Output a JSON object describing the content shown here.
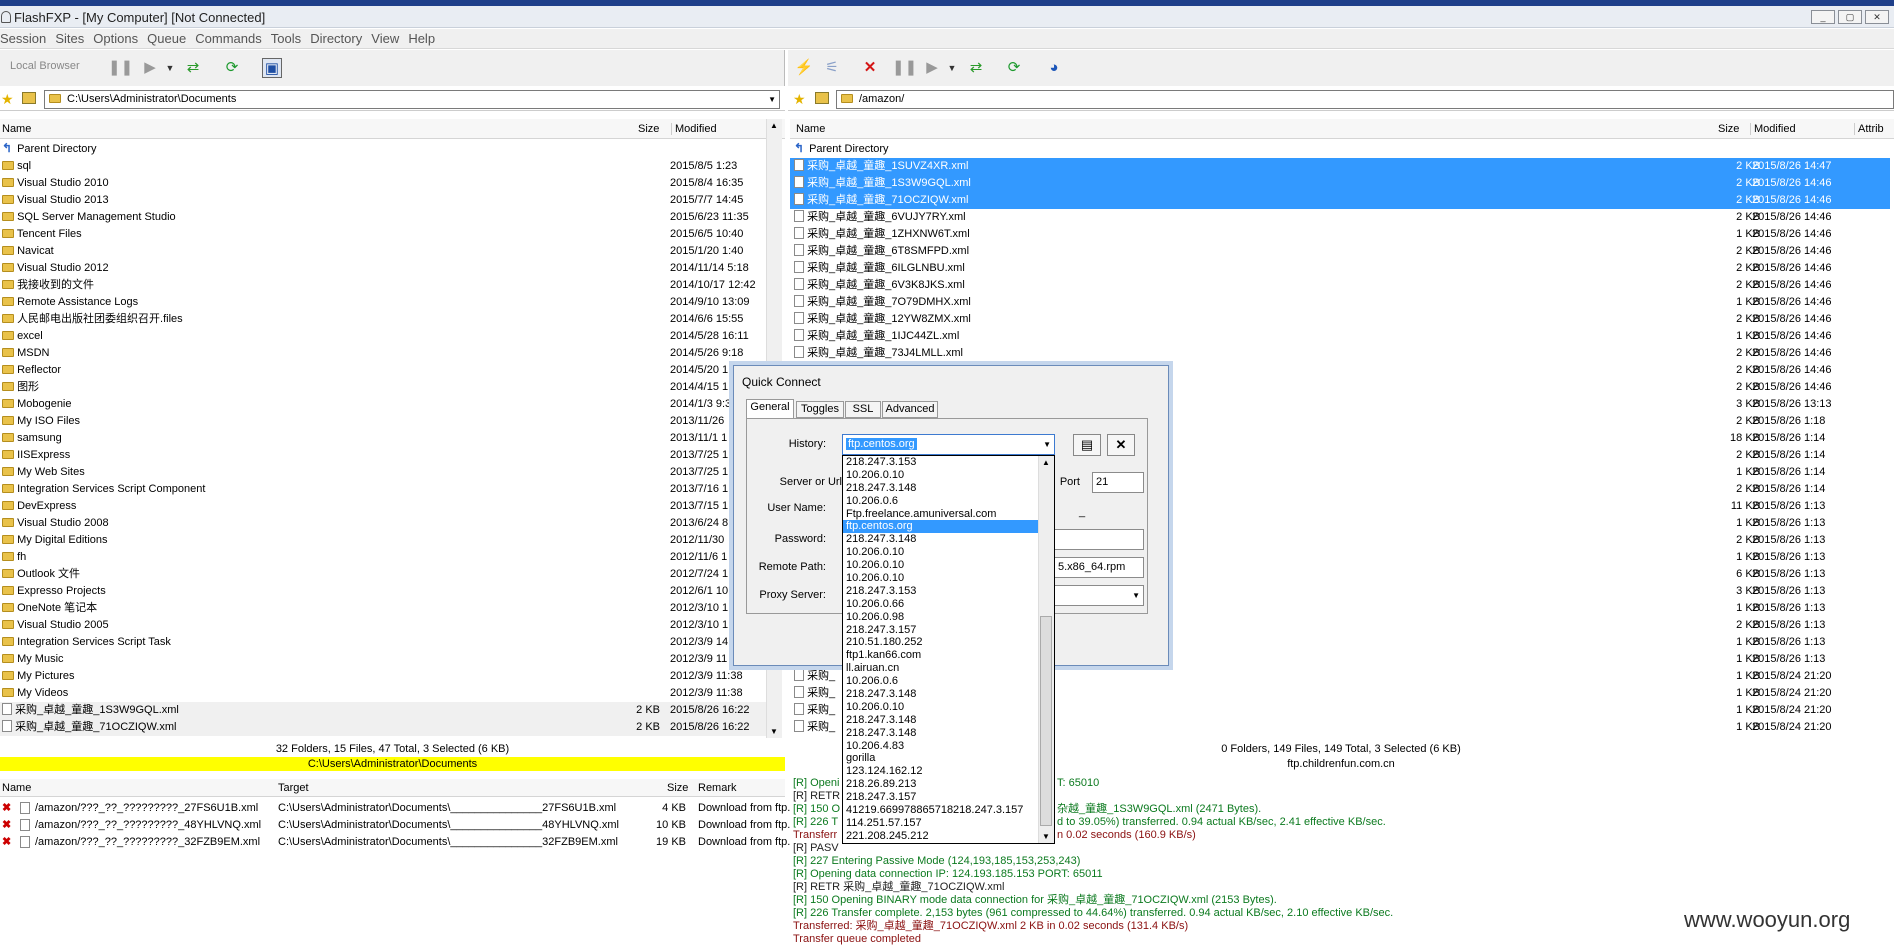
{
  "window": {
    "title": "FlashFXP - [My Computer]   [Not Connected]",
    "controls": [
      "_",
      "▢",
      "✕"
    ]
  },
  "menu": [
    "Session",
    "Sites",
    "Options",
    "Queue",
    "Commands",
    "Tools",
    "Directory",
    "View",
    "Help"
  ],
  "left": {
    "toolbar_label": "Local Browser",
    "path": "C:\\Users\\Administrator\\Documents",
    "columns": {
      "name": "Name",
      "size": "Size",
      "modified": "Modified"
    },
    "parent": "Parent Directory",
    "rows": [
      {
        "name": "sql",
        "size": "",
        "modified": "2015/8/5 1:23",
        "type": "folder"
      },
      {
        "name": "Visual Studio 2010",
        "size": "",
        "modified": "2015/8/4 16:35",
        "type": "folder"
      },
      {
        "name": "Visual Studio 2013",
        "size": "",
        "modified": "2015/7/7 14:45",
        "type": "folder"
      },
      {
        "name": "SQL Server Management Studio",
        "size": "",
        "modified": "2015/6/23 11:35",
        "type": "folder"
      },
      {
        "name": "Tencent Files",
        "size": "",
        "modified": "2015/6/5 10:40",
        "type": "folder"
      },
      {
        "name": "Navicat",
        "size": "",
        "modified": "2015/1/20 1:40",
        "type": "folder"
      },
      {
        "name": "Visual Studio 2012",
        "size": "",
        "modified": "2014/11/14 5:18",
        "type": "folder"
      },
      {
        "name": "我接收到的文件",
        "size": "",
        "modified": "2014/10/17 12:42",
        "type": "folder"
      },
      {
        "name": "Remote Assistance Logs",
        "size": "",
        "modified": "2014/9/10 13:09",
        "type": "folder"
      },
      {
        "name": "人民邮电出版社团委组织召开.files",
        "size": "",
        "modified": "2014/6/6 15:55",
        "type": "folder"
      },
      {
        "name": "excel",
        "size": "",
        "modified": "2014/5/28 16:11",
        "type": "folder"
      },
      {
        "name": "MSDN",
        "size": "",
        "modified": "2014/5/26 9:18",
        "type": "folder"
      },
      {
        "name": "Reflector",
        "size": "",
        "modified": "2014/5/20 1",
        "type": "folder"
      },
      {
        "name": "图形",
        "size": "",
        "modified": "2014/4/15 1",
        "type": "folder"
      },
      {
        "name": "Mobogenie",
        "size": "",
        "modified": "2014/1/3 9:3",
        "type": "folder"
      },
      {
        "name": "My ISO Files",
        "size": "",
        "modified": "2013/11/26",
        "type": "folder"
      },
      {
        "name": "samsung",
        "size": "",
        "modified": "2013/11/1 1",
        "type": "folder"
      },
      {
        "name": "IISExpress",
        "size": "",
        "modified": "2013/7/25 1",
        "type": "folder"
      },
      {
        "name": "My Web Sites",
        "size": "",
        "modified": "2013/7/25 1",
        "type": "folder"
      },
      {
        "name": "Integration Services Script Component",
        "size": "",
        "modified": "2013/7/16 1",
        "type": "folder"
      },
      {
        "name": "DevExpress",
        "size": "",
        "modified": "2013/7/15 1",
        "type": "folder"
      },
      {
        "name": "Visual Studio 2008",
        "size": "",
        "modified": "2013/6/24 8",
        "type": "folder"
      },
      {
        "name": "My Digital Editions",
        "size": "",
        "modified": "2012/11/30",
        "type": "folder"
      },
      {
        "name": "fh",
        "size": "",
        "modified": "2012/11/6 1",
        "type": "folder"
      },
      {
        "name": "Outlook 文件",
        "size": "",
        "modified": "2012/7/24 1",
        "type": "folder"
      },
      {
        "name": "Expresso Projects",
        "size": "",
        "modified": "2012/6/1 10",
        "type": "folder"
      },
      {
        "name": "OneNote 笔记本",
        "size": "",
        "modified": "2012/3/10 1",
        "type": "folder"
      },
      {
        "name": "Visual Studio 2005",
        "size": "",
        "modified": "2012/3/10 1",
        "type": "folder"
      },
      {
        "name": "Integration Services Script Task",
        "size": "",
        "modified": "2012/3/9 14",
        "type": "folder"
      },
      {
        "name": "My Music",
        "size": "",
        "modified": "2012/3/9 11",
        "type": "folder"
      },
      {
        "name": "My Pictures",
        "size": "",
        "modified": "2012/3/9 11:38",
        "type": "folder"
      },
      {
        "name": "My Videos",
        "size": "",
        "modified": "2012/3/9 11:38",
        "type": "folder"
      },
      {
        "name": "采购_卓越_童趣_1S3W9GQL.xml",
        "size": "2 KB",
        "modified": "2015/8/26 16:22",
        "type": "file"
      },
      {
        "name": "采购_卓越_童趣_71OCZIQW.xml",
        "size": "2 KB",
        "modified": "2015/8/26 16:22",
        "type": "file"
      }
    ],
    "status": "32 Folders, 15 Files, 47 Total, 3 Selected (6 KB)",
    "status_path": "C:\\Users\\Administrator\\Documents"
  },
  "right": {
    "path": "/amazon/",
    "columns": {
      "name": "Name",
      "size": "Size",
      "modified": "Modified",
      "attrib": "Attrib"
    },
    "parent": "Parent Directory",
    "rows": [
      {
        "name": "采购_卓越_童趣_1SUVZ4XR.xml",
        "size": "2 KB",
        "modified": "2015/8/26 14:47",
        "sel": true
      },
      {
        "name": "采购_卓越_童趣_1S3W9GQL.xml",
        "size": "2 KB",
        "modified": "2015/8/26 14:46",
        "sel": true
      },
      {
        "name": "采购_卓越_童趣_71OCZIQW.xml",
        "size": "2 KB",
        "modified": "2015/8/26 14:46",
        "sel": true
      },
      {
        "name": "采购_卓越_童趣_6VUJY7RY.xml",
        "size": "2 KB",
        "modified": "2015/8/26 14:46",
        "sel": false
      },
      {
        "name": "采购_卓越_童趣_1ZHXNW6T.xml",
        "size": "1 KB",
        "modified": "2015/8/26 14:46",
        "sel": false
      },
      {
        "name": "采购_卓越_童趣_6T8SMFPD.xml",
        "size": "2 KB",
        "modified": "2015/8/26 14:46",
        "sel": false
      },
      {
        "name": "采购_卓越_童趣_6ILGLNBU.xml",
        "size": "2 KB",
        "modified": "2015/8/26 14:46",
        "sel": false
      },
      {
        "name": "采购_卓越_童趣_6V3K8JKS.xml",
        "size": "2 KB",
        "modified": "2015/8/26 14:46",
        "sel": false
      },
      {
        "name": "采购_卓越_童趣_7O79DMHX.xml",
        "size": "1 KB",
        "modified": "2015/8/26 14:46",
        "sel": false
      },
      {
        "name": "采购_卓越_童趣_12YW8ZMX.xml",
        "size": "2 KB",
        "modified": "2015/8/26 14:46",
        "sel": false
      },
      {
        "name": "采购_卓越_童趣_1IJC44ZL.xml",
        "size": "1 KB",
        "modified": "2015/8/26 14:46",
        "sel": false
      },
      {
        "name": "采购_卓越_童趣_73J4LMLL.xml",
        "size": "2 KB",
        "modified": "2015/8/26 14:46",
        "sel": false
      },
      {
        "name": "",
        "size": "2 KB",
        "modified": "2015/8/26 14:46",
        "sel": false
      },
      {
        "name": "",
        "size": "2 KB",
        "modified": "2015/8/26 14:46",
        "sel": false
      },
      {
        "name": "",
        "size": "3 KB",
        "modified": "2015/8/26 13:13",
        "sel": false
      },
      {
        "name": "",
        "size": "2 KB",
        "modified": "2015/8/26 1:18",
        "sel": false
      },
      {
        "name": "",
        "size": "18 KB",
        "modified": "2015/8/26 1:14",
        "sel": false
      },
      {
        "name": "",
        "size": "2 KB",
        "modified": "2015/8/26 1:14",
        "sel": false
      },
      {
        "name": "",
        "size": "1 KB",
        "modified": "2015/8/26 1:14",
        "sel": false
      },
      {
        "name": "",
        "size": "2 KB",
        "modified": "2015/8/26 1:14",
        "sel": false
      },
      {
        "name": "",
        "size": "11 KB",
        "modified": "2015/8/26 1:13",
        "sel": false
      },
      {
        "name": "",
        "size": "1 KB",
        "modified": "2015/8/26 1:13",
        "sel": false
      },
      {
        "name": "",
        "size": "2 KB",
        "modified": "2015/8/26 1:13",
        "sel": false
      },
      {
        "name": "",
        "size": "1 KB",
        "modified": "2015/8/26 1:13",
        "sel": false
      },
      {
        "name": "",
        "size": "6 KB",
        "modified": "2015/8/26 1:13",
        "sel": false
      },
      {
        "name": "",
        "size": "3 KB",
        "modified": "2015/8/26 1:13",
        "sel": false
      },
      {
        "name": "",
        "size": "1 KB",
        "modified": "2015/8/26 1:13",
        "sel": false
      },
      {
        "name": "",
        "size": "2 KB",
        "modified": "2015/8/26 1:13",
        "sel": false
      },
      {
        "name": "",
        "size": "1 KB",
        "modified": "2015/8/26 1:13",
        "sel": false
      },
      {
        "name": "",
        "size": "1 KB",
        "modified": "2015/8/26 1:13",
        "sel": false
      },
      {
        "name": "采购_",
        "size": "1 KB",
        "modified": "2015/8/24 21:20",
        "sel": false
      },
      {
        "name": "采购_",
        "size": "1 KB",
        "modified": "2015/8/24 21:20",
        "sel": false
      },
      {
        "name": "采购_",
        "size": "1 KB",
        "modified": "2015/8/24 21:20",
        "sel": false
      },
      {
        "name": "采购_",
        "size": "1 KB",
        "modified": "2015/8/24 21:20",
        "sel": false
      }
    ],
    "status": "0 Folders, 149 Files, 149 Total, 3 Selected (6 KB)",
    "status_host": "ftp.childrenfun.com.cn"
  },
  "queue": {
    "columns": {
      "name": "Name",
      "target": "Target",
      "size": "Size",
      "remark": "Remark"
    },
    "rows": [
      {
        "name": "/amazon/???_??_?????????_27FS6U1B.xml",
        "target": "C:\\Users\\Administrator\\Documents\\_______________27FS6U1B.xml",
        "size": "4 KB",
        "remark": "Download from ftp."
      },
      {
        "name": "/amazon/???_??_?????????_48YHLVNQ.xml",
        "target": "C:\\Users\\Administrator\\Documents\\_______________48YHLVNQ.xml",
        "size": "10 KB",
        "remark": "Download from ftp."
      },
      {
        "name": "/amazon/???_??_?????????_32FZB9EM.xml",
        "target": "C:\\Users\\Administrator\\Documents\\_______________32FZB9EM.xml",
        "size": "19 KB",
        "remark": "Download from ftp."
      }
    ]
  },
  "log": [
    {
      "text": "[R] Openi",
      "tail": "T: 65010",
      "c": "g"
    },
    {
      "text": "[R] RETR",
      "tail": "",
      "c": "d"
    },
    {
      "text": "[R] 150 O",
      "tail": "杂越_童趣_1S3W9GQL.xml (2471 Bytes).",
      "c": "g"
    },
    {
      "text": "[R] 226 T",
      "tail": "d to 39.05%) transferred. 0.94 actual KB/sec,  2.41 effective KB/sec.",
      "c": "g"
    },
    {
      "text": "Transferr",
      "tail": "n 0.02 seconds (160.9 KB/s)",
      "c": "r"
    },
    {
      "text": "[R] PASV",
      "tail": "",
      "c": "d"
    },
    {
      "text": "[R] 227 Entering Passive Mode (124,193,185,153,253,243)",
      "tail": "",
      "c": "g"
    },
    {
      "text": "[R] Opening data connection IP: 124.193.185.153 PORT: 65011",
      "tail": "",
      "c": "g"
    },
    {
      "text": "[R] RETR 采购_卓越_童趣_71OCZIQW.xml",
      "tail": "",
      "c": "d"
    },
    {
      "text": "[R] 150 Opening BINARY mode data connection for 采购_卓越_童趣_71OCZIQW.xml (2153 Bytes).",
      "tail": "",
      "c": "g"
    },
    {
      "text": "[R] 226 Transfer complete. 2,153 bytes (961 compressed to 44.64%) transferred. 0.94 actual KB/sec,  2.10 effective KB/sec.",
      "tail": "",
      "c": "g"
    },
    {
      "text": "Transferred: 采购_卓越_童趣_71OCZIQW.xml 2 KB in 0.02 seconds (131.4 KB/s)",
      "tail": "",
      "c": "r"
    },
    {
      "text": "Transfer queue completed",
      "tail": "",
      "c": "r"
    }
  ],
  "dialog": {
    "title": "Quick Connect",
    "tabs": [
      "General",
      "Toggles",
      "SSL",
      "Advanced"
    ],
    "labels": {
      "history": "History:",
      "server": "Server or Url",
      "port": "Port",
      "user": "User Name:",
      "password": "Password:",
      "remote_path": "Remote Path:",
      "proxy": "Proxy Server:"
    },
    "history_value": "ftp.centos.org",
    "port_value": "21",
    "remote_path_partial": "5.x86_64.rpm",
    "dash_text": "_",
    "history_options": [
      "218.247.3.153",
      "10.206.0.10",
      "218.247.3.148",
      "10.206.0.6",
      "Ftp.freelance.amuniversal.com",
      "ftp.centos.org",
      "218.247.3.148",
      "10.206.0.10",
      "10.206.0.10",
      "10.206.0.10",
      "218.247.3.153",
      "10.206.0.66",
      "10.206.0.98",
      "218.247.3.157",
      "210.51.180.252",
      "ftp1.kan66.com",
      "ll.airuan.cn",
      "10.206.0.6",
      "218.247.3.148",
      "10.206.0.10",
      "218.247.3.148",
      "218.247.3.148",
      "10.206.4.83",
      "gorilla",
      "123.124.162.12",
      "218.26.89.213",
      "218.247.3.157",
      "41219.669978865718218.247.3.157",
      "114.251.57.157",
      "221.208.245.212"
    ],
    "history_selected_index": 5
  },
  "watermark": "www.wooyun.org"
}
